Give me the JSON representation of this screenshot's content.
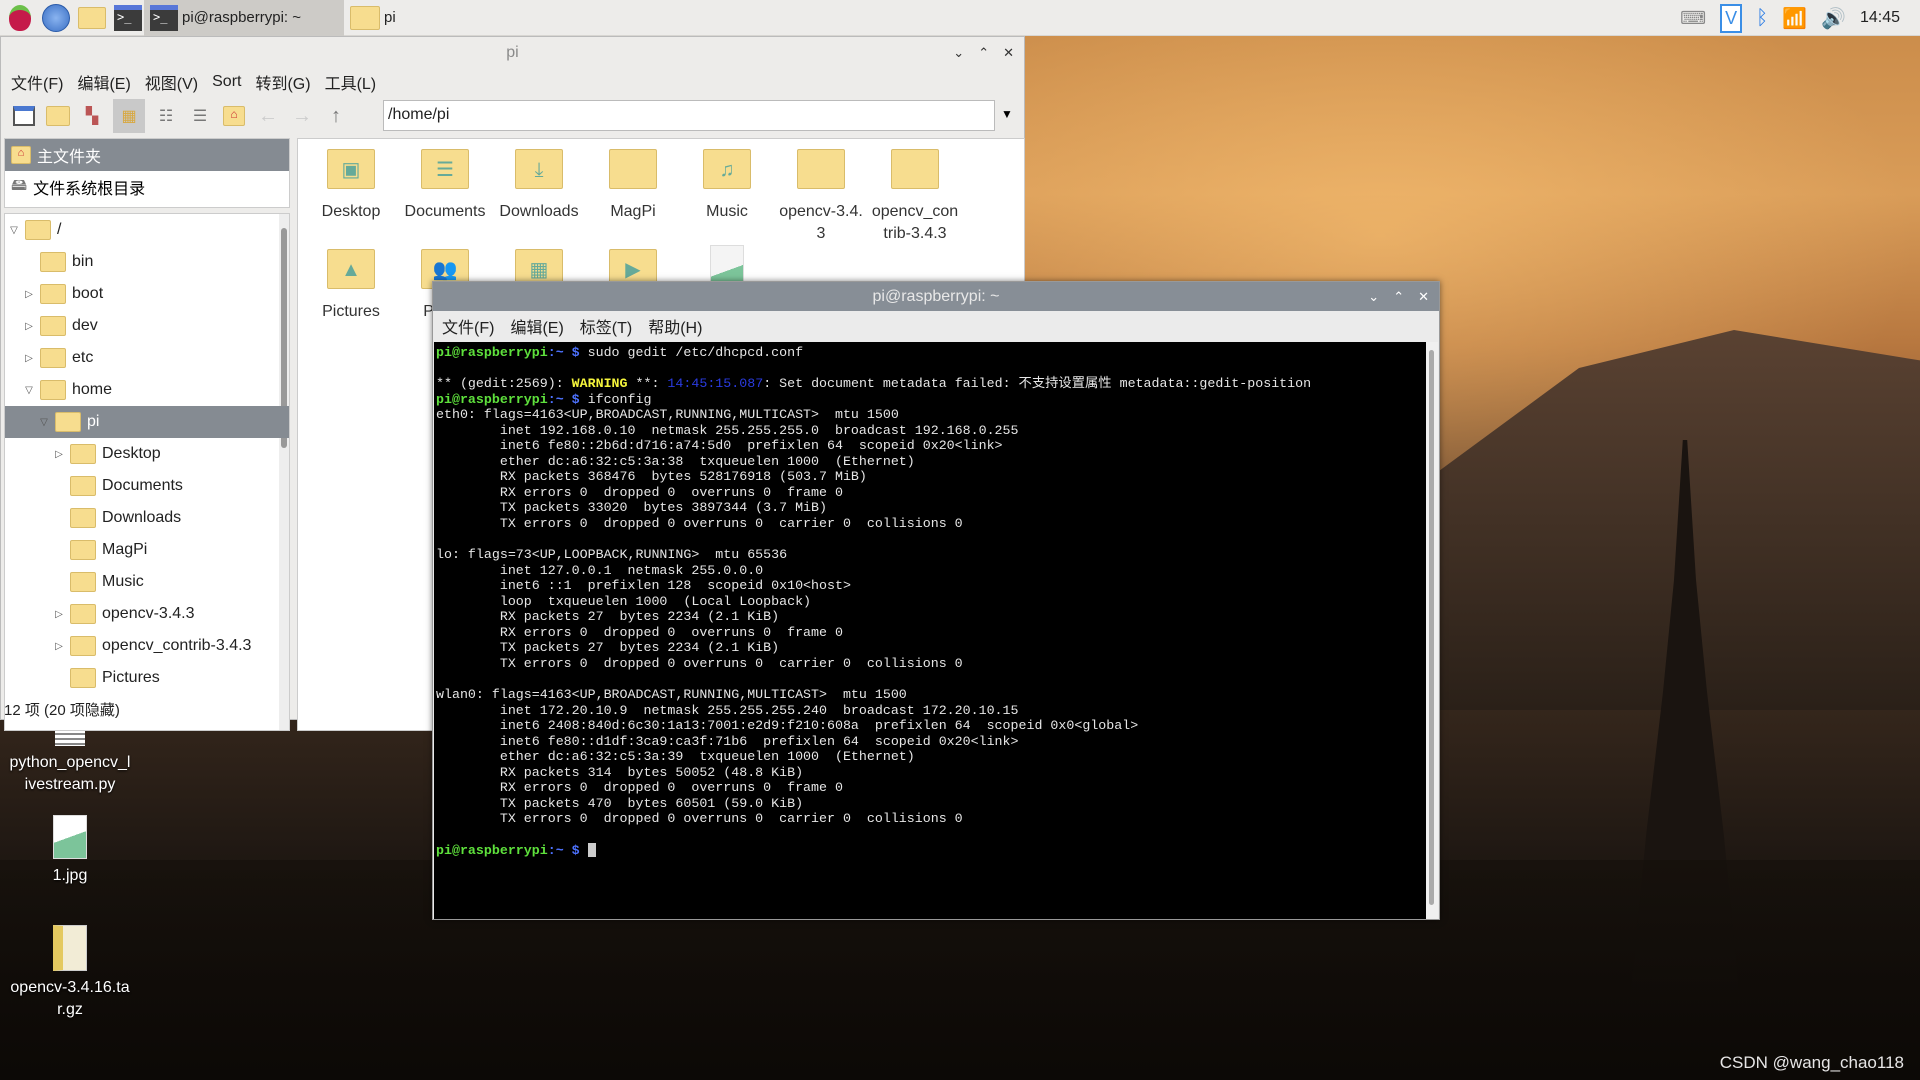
{
  "taskbar": {
    "tasks": [
      {
        "label": "pi@raspberrypi: ~",
        "icon": "terminal-icon",
        "active": true
      },
      {
        "label": "pi",
        "icon": "folder-icon",
        "active": false
      }
    ],
    "clock": "14:45",
    "tray": [
      "keyboard-icon",
      "vnc-icon",
      "bluetooth-icon",
      "wifi-icon",
      "volume-icon"
    ]
  },
  "file_manager": {
    "title": "pi",
    "menu": [
      "文件(F)",
      "编辑(E)",
      "视图(V)",
      "Sort",
      "转到(G)",
      "工具(L)"
    ],
    "address": "/home/pi",
    "places": [
      {
        "label": "主文件夹",
        "selected": true
      },
      {
        "label": "文件系统根目录",
        "selected": false
      }
    ],
    "tree": [
      {
        "label": "/",
        "depth": 0,
        "expander": "open"
      },
      {
        "label": "bin",
        "depth": 1,
        "expander": ""
      },
      {
        "label": "boot",
        "depth": 1,
        "expander": "closed"
      },
      {
        "label": "dev",
        "depth": 1,
        "expander": "closed"
      },
      {
        "label": "etc",
        "depth": 1,
        "expander": "closed"
      },
      {
        "label": "home",
        "depth": 1,
        "expander": "open"
      },
      {
        "label": "pi",
        "depth": 2,
        "expander": "open",
        "selected": true
      },
      {
        "label": "Desktop",
        "depth": 3,
        "expander": "closed"
      },
      {
        "label": "Documents",
        "depth": 3,
        "expander": ""
      },
      {
        "label": "Downloads",
        "depth": 3,
        "expander": ""
      },
      {
        "label": "MagPi",
        "depth": 3,
        "expander": ""
      },
      {
        "label": "Music",
        "depth": 3,
        "expander": ""
      },
      {
        "label": "opencv-3.4.3",
        "depth": 3,
        "expander": "closed"
      },
      {
        "label": "opencv_contrib-3.4.3",
        "depth": 3,
        "expander": "closed"
      },
      {
        "label": "Pictures",
        "depth": 3,
        "expander": ""
      }
    ],
    "items": [
      {
        "label": "Desktop",
        "emblem": "▣"
      },
      {
        "label": "Documents",
        "emblem": "☰"
      },
      {
        "label": "Downloads",
        "emblem": "⤓"
      },
      {
        "label": "MagPi",
        "emblem": ""
      },
      {
        "label": "Music",
        "emblem": "♫"
      },
      {
        "label": "opencv-3.4.\n3",
        "emblem": ""
      },
      {
        "label": "opencv_con\ntrib-3.4.3",
        "emblem": ""
      },
      {
        "label": "Pictures",
        "emblem": "▲"
      },
      {
        "label": "Public",
        "emblem": "👥"
      },
      {
        "label": "",
        "emblem": "▦"
      },
      {
        "label": "",
        "emblem": "▶"
      },
      {
        "label": "",
        "emblem": "image"
      }
    ],
    "status": "12 项 (20 项隐藏)"
  },
  "terminal": {
    "title": "pi@raspberrypi: ~",
    "menu": [
      "文件(F)",
      "编辑(E)",
      "标签(T)",
      "帮助(H)"
    ],
    "prompt_user": "pi@raspberrypi",
    "prompt_dir": ":~ $",
    "lines": [
      {
        "type": "prompt",
        "text": " sudo gedit /etc/dhcpcd.conf"
      },
      {
        "type": "plain",
        "text": ""
      },
      {
        "type": "warning",
        "pre": "** (gedit:2569): ",
        "warn": "WARNING",
        "mid": " **: ",
        "ts": "14:45:15.087",
        "text": ": Set document metadata failed: 不支持设置属性 metadata::gedit-position"
      },
      {
        "type": "prompt",
        "text": " ifconfig"
      },
      {
        "type": "plain",
        "text": "eth0: flags=4163<UP,BROADCAST,RUNNING,MULTICAST>  mtu 1500"
      },
      {
        "type": "plain",
        "text": "        inet 192.168.0.10  netmask 255.255.255.0  broadcast 192.168.0.255"
      },
      {
        "type": "plain",
        "text": "        inet6 fe80::2b6d:d716:a74:5d0  prefixlen 64  scopeid 0x20<link>"
      },
      {
        "type": "plain",
        "text": "        ether dc:a6:32:c5:3a:38  txqueuelen 1000  (Ethernet)"
      },
      {
        "type": "plain",
        "text": "        RX packets 368476  bytes 528176918 (503.7 MiB)"
      },
      {
        "type": "plain",
        "text": "        RX errors 0  dropped 0  overruns 0  frame 0"
      },
      {
        "type": "plain",
        "text": "        TX packets 33020  bytes 3897344 (3.7 MiB)"
      },
      {
        "type": "plain",
        "text": "        TX errors 0  dropped 0 overruns 0  carrier 0  collisions 0"
      },
      {
        "type": "plain",
        "text": ""
      },
      {
        "type": "plain",
        "text": "lo: flags=73<UP,LOOPBACK,RUNNING>  mtu 65536"
      },
      {
        "type": "plain",
        "text": "        inet 127.0.0.1  netmask 255.0.0.0"
      },
      {
        "type": "plain",
        "text": "        inet6 ::1  prefixlen 128  scopeid 0x10<host>"
      },
      {
        "type": "plain",
        "text": "        loop  txqueuelen 1000  (Local Loopback)"
      },
      {
        "type": "plain",
        "text": "        RX packets 27  bytes 2234 (2.1 KiB)"
      },
      {
        "type": "plain",
        "text": "        RX errors 0  dropped 0  overruns 0  frame 0"
      },
      {
        "type": "plain",
        "text": "        TX packets 27  bytes 2234 (2.1 KiB)"
      },
      {
        "type": "plain",
        "text": "        TX errors 0  dropped 0 overruns 0  carrier 0  collisions 0"
      },
      {
        "type": "plain",
        "text": ""
      },
      {
        "type": "plain",
        "text": "wlan0: flags=4163<UP,BROADCAST,RUNNING,MULTICAST>  mtu 1500"
      },
      {
        "type": "plain",
        "text": "        inet 172.20.10.9  netmask 255.255.255.240  broadcast 172.20.10.15"
      },
      {
        "type": "plain",
        "text": "        inet6 2408:840d:6c30:1a13:7001:e2d9:f210:608a  prefixlen 64  scopeid 0x0<global>"
      },
      {
        "type": "plain",
        "text": "        inet6 fe80::d1df:3ca9:ca3f:71b6  prefixlen 64  scopeid 0x20<link>"
      },
      {
        "type": "plain",
        "text": "        ether dc:a6:32:c5:3a:39  txqueuelen 1000  (Ethernet)"
      },
      {
        "type": "plain",
        "text": "        RX packets 314  bytes 50052 (48.8 KiB)"
      },
      {
        "type": "plain",
        "text": "        RX errors 0  dropped 0  overruns 0  frame 0"
      },
      {
        "type": "plain",
        "text": "        TX packets 470  bytes 60501 (59.0 KiB)"
      },
      {
        "type": "plain",
        "text": "        TX errors 0  dropped 0 overruns 0  carrier 0  collisions 0"
      },
      {
        "type": "plain",
        "text": ""
      },
      {
        "type": "prompt",
        "text": " ",
        "cursor": true
      }
    ]
  },
  "desktop": {
    "icons": [
      {
        "label": "python_opencv_l\nivestream.py",
        "icon": "text-file-icon"
      },
      {
        "label": "1.jpg",
        "icon": "image-file-icon"
      },
      {
        "label": "opencv-3.4.16.ta\nr.gz",
        "icon": "archive-icon"
      }
    ]
  },
  "watermark": "CSDN @wang_chao118"
}
